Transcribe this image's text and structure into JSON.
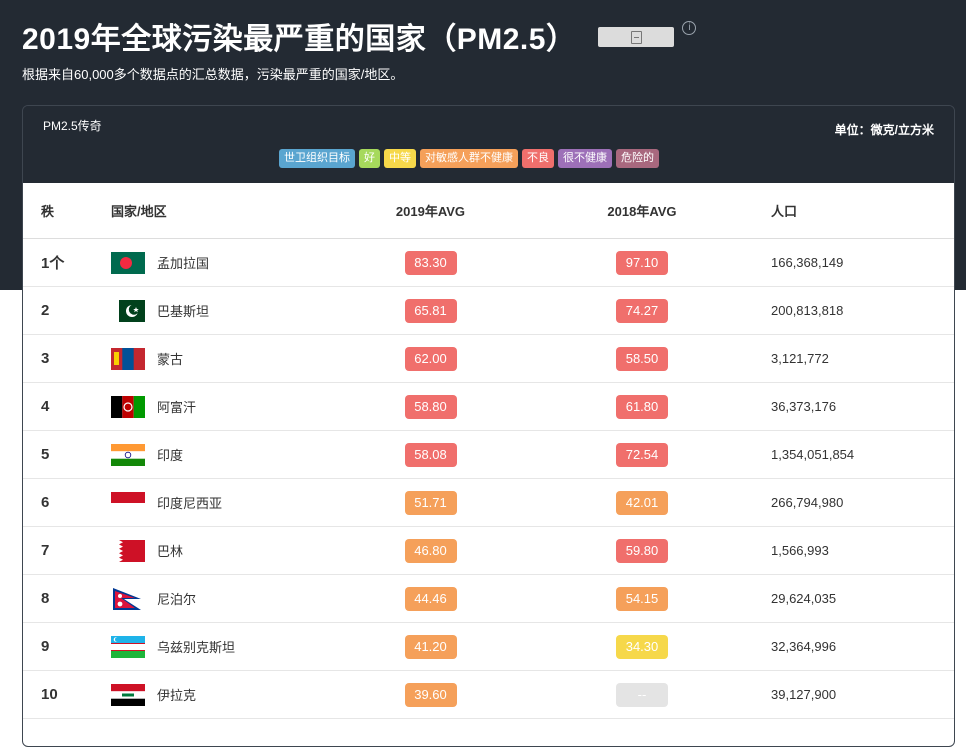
{
  "header": {
    "title": "2019年全球污染最严重的国家（PM2.5）",
    "subtitle": "根据来自60,000多个数据点的汇总数据，污染最严重的国家/地区。"
  },
  "card": {
    "legend_title": "PM2.5传奇",
    "unit": "单位：微克/立方米",
    "legend": [
      {
        "label": "世卫组织目标",
        "color": "#5aa5d0"
      },
      {
        "label": "好",
        "color": "#a6d95c"
      },
      {
        "label": "中等",
        "color": "#f6d84a"
      },
      {
        "label": "对敏感人群不健康",
        "color": "#f5a05a"
      },
      {
        "label": "不良",
        "color": "#ef6f6c"
      },
      {
        "label": "很不健康",
        "color": "#9d70b8"
      },
      {
        "label": "危险的",
        "color": "#a8687e"
      }
    ]
  },
  "table": {
    "headers": {
      "rank": "秩",
      "country": "国家/地区",
      "avg2019": "2019年AVG",
      "avg2018": "2018年AVG",
      "population": "人口"
    },
    "rows": [
      {
        "rank": "1个",
        "country": "孟加拉国",
        "flag": "bangladesh",
        "avg2019": "83.30",
        "avg2018": "97.10",
        "c2019": "#f06f6c",
        "c2018": "#f06f6c",
        "population": "166,368,149"
      },
      {
        "rank": "2",
        "country": "巴基斯坦",
        "flag": "pakistan",
        "avg2019": "65.81",
        "avg2018": "74.27",
        "c2019": "#f06f6c",
        "c2018": "#f06f6c",
        "population": "200,813,818"
      },
      {
        "rank": "3",
        "country": "蒙古",
        "flag": "mongolia",
        "avg2019": "62.00",
        "avg2018": "58.50",
        "c2019": "#f06f6c",
        "c2018": "#f06f6c",
        "population": "3,121,772"
      },
      {
        "rank": "4",
        "country": "阿富汗",
        "flag": "afghanistan",
        "avg2019": "58.80",
        "avg2018": "61.80",
        "c2019": "#f06f6c",
        "c2018": "#f06f6c",
        "population": "36,373,176"
      },
      {
        "rank": "5",
        "country": "印度",
        "flag": "india",
        "avg2019": "58.08",
        "avg2018": "72.54",
        "c2019": "#f06f6c",
        "c2018": "#f06f6c",
        "population": "1,354,051,854"
      },
      {
        "rank": "6",
        "country": "印度尼西亚",
        "flag": "indonesia",
        "avg2019": "51.71",
        "avg2018": "42.01",
        "c2019": "#f5a05a",
        "c2018": "#f5a05a",
        "population": "266,794,980"
      },
      {
        "rank": "7",
        "country": "巴林",
        "flag": "bahrain",
        "avg2019": "46.80",
        "avg2018": "59.80",
        "c2019": "#f5a05a",
        "c2018": "#f06f6c",
        "population": "1,566,993"
      },
      {
        "rank": "8",
        "country": "尼泊尔",
        "flag": "nepal",
        "avg2019": "44.46",
        "avg2018": "54.15",
        "c2019": "#f5a05a",
        "c2018": "#f5a05a",
        "population": "29,624,035"
      },
      {
        "rank": "9",
        "country": "乌兹别克斯坦",
        "flag": "uzbekistan",
        "avg2019": "41.20",
        "avg2018": "34.30",
        "c2019": "#f5a05a",
        "c2018": "#f6d84a",
        "population": "32,364,996"
      },
      {
        "rank": "10",
        "country": "伊拉克",
        "flag": "iraq",
        "avg2019": "39.60",
        "avg2018": "--",
        "c2019": "#f5a05a",
        "c2018": "#e4e4e4",
        "population": "39,127,900"
      }
    ]
  }
}
